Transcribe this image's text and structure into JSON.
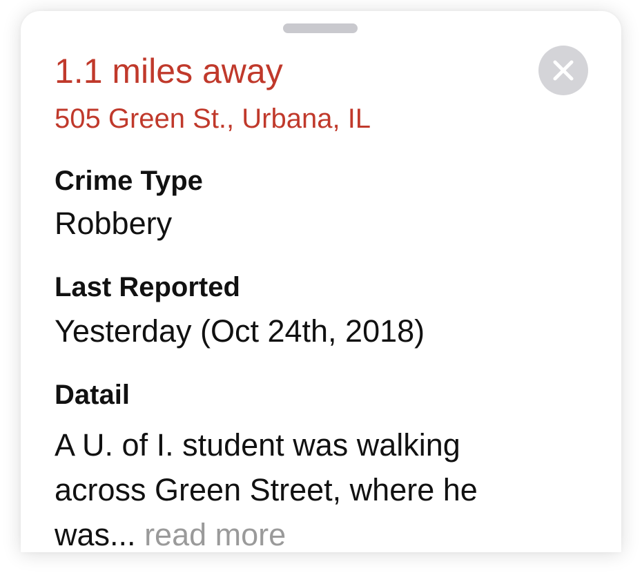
{
  "card": {
    "distance": "1.1 miles away",
    "address": "505 Green St., Urbana, IL",
    "close_icon": "close-icon",
    "accent_color": "#c0392b"
  },
  "fields": {
    "crime_type_label": "Crime Type",
    "crime_type_value": "Robbery",
    "last_reported_label": "Last Reported",
    "last_reported_value": "Yesterday (Oct 24th, 2018)",
    "detail_label": "Datail",
    "detail_line1": "A U. of I. student was walking",
    "detail_line2": "across Green Street, where he",
    "detail_line3": "was...",
    "read_more": "read more"
  }
}
